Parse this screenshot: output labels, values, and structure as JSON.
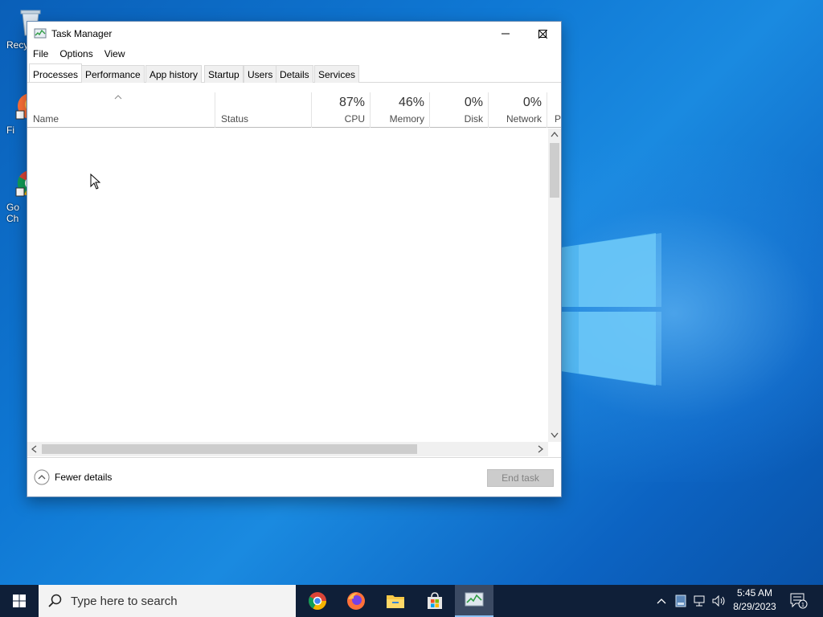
{
  "desktop": {
    "icons": [
      {
        "label": "Recy"
      },
      {
        "label": "Fi"
      },
      {
        "label": "Go"
      },
      {
        "label": "Ch"
      }
    ]
  },
  "window": {
    "title": "Task Manager",
    "controls": {
      "minimize": "–",
      "maximize": "☐",
      "close": "✕"
    }
  },
  "menu": [
    "File",
    "Options",
    "View"
  ],
  "tabs": [
    "Processes",
    "Performance",
    "App history",
    "Startup",
    "Users",
    "Details",
    "Services"
  ],
  "active_tab": "Processes",
  "columns": {
    "name": {
      "label": "Name"
    },
    "status": {
      "label": "Status"
    },
    "cpu": {
      "label": "CPU",
      "value": "87%"
    },
    "memory": {
      "label": "Memory",
      "value": "46%"
    },
    "disk": {
      "label": "Disk",
      "value": "0%"
    },
    "network": {
      "label": "Network",
      "value": "0%"
    },
    "power": {
      "label": "P"
    }
  },
  "footer": {
    "fewer_details": "Fewer details",
    "end_task": "End task"
  },
  "taskbar": {
    "search_placeholder": "Type here to search",
    "time": "5:45 AM",
    "date": "8/29/2023",
    "notification_count": "1"
  },
  "colors": {
    "taskbar_bg": "#0f1f38",
    "desktop_accent": "#0f78d4",
    "end_task_disabled": "#cccccc"
  }
}
